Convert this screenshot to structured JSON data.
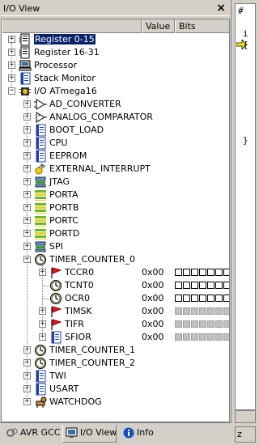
{
  "panel": {
    "title": "I/O View",
    "close_label": "×"
  },
  "columns": {
    "name": "",
    "value": "Value",
    "bits": "Bits"
  },
  "rows": [
    {
      "label": "Register 0-15",
      "icon": "register-file-icon",
      "level": 0,
      "expander": "+",
      "selected": true
    },
    {
      "label": "Register 16-31",
      "icon": "register-file-icon",
      "level": 0,
      "expander": "+"
    },
    {
      "label": "Processor",
      "icon": "processor-computer-icon",
      "level": 0,
      "expander": "+"
    },
    {
      "label": "Stack Monitor",
      "icon": "document-blue-icon",
      "level": 0,
      "expander": "+"
    },
    {
      "label": "I/O ATmega16",
      "icon": "chip-icon",
      "level": 0,
      "expander": "−"
    },
    {
      "label": "AD_CONVERTER",
      "icon": "analog-converter-icon",
      "level": 1,
      "expander": "+"
    },
    {
      "label": "ANALOG_COMPARATOR",
      "icon": "analog-comparator-icon",
      "level": 1,
      "expander": "+"
    },
    {
      "label": "BOOT_LOAD",
      "icon": "document-blue-icon",
      "level": 1,
      "expander": "+"
    },
    {
      "label": "CPU",
      "icon": "document-blue-icon",
      "level": 1,
      "expander": "+"
    },
    {
      "label": "EEPROM",
      "icon": "document-blue-icon",
      "level": 1,
      "expander": "+"
    },
    {
      "label": "EXTERNAL_INTERRUPT",
      "icon": "interrupt-icon",
      "level": 1,
      "expander": "+"
    },
    {
      "label": "JTAG",
      "icon": "jtag-icon",
      "level": 1,
      "expander": "+"
    },
    {
      "label": "PORTA",
      "icon": "port-icon",
      "level": 1,
      "expander": "+"
    },
    {
      "label": "PORTB",
      "icon": "port-icon",
      "level": 1,
      "expander": "+"
    },
    {
      "label": "PORTC",
      "icon": "port-icon",
      "level": 1,
      "expander": "+"
    },
    {
      "label": "PORTD",
      "icon": "port-icon",
      "level": 1,
      "expander": "+"
    },
    {
      "label": "SPI",
      "icon": "spi-icon",
      "level": 1,
      "expander": "+"
    },
    {
      "label": "TIMER_COUNTER_0",
      "icon": "timer-clock-icon",
      "level": 1,
      "expander": "−"
    },
    {
      "label": "TCCR0",
      "icon": "flag-icon",
      "level": 2,
      "expander": "+",
      "value": "0x00",
      "bits": "open"
    },
    {
      "label": "TCNT0",
      "icon": "timer-clock-icon",
      "level": 2,
      "value": "0x00",
      "bits": "open"
    },
    {
      "label": "OCR0",
      "icon": "timer-clock-icon",
      "level": 2,
      "value": "0x00",
      "bits": "open"
    },
    {
      "label": "TIMSK",
      "icon": "flag-icon",
      "level": 2,
      "expander": "+",
      "value": "0x00",
      "bits": "na"
    },
    {
      "label": "TIFR",
      "icon": "flag-icon",
      "level": 2,
      "expander": "+",
      "value": "0x00",
      "bits": "na"
    },
    {
      "label": "SFIOR",
      "icon": "document-blue-icon",
      "level": 2,
      "expander": "+",
      "value": "0x00",
      "bits": "na"
    },
    {
      "label": "TIMER_COUNTER_1",
      "icon": "timer-clock-icon",
      "level": 1,
      "expander": "+"
    },
    {
      "label": "TIMER_COUNTER_2",
      "icon": "timer-clock-icon",
      "level": 1,
      "expander": "+"
    },
    {
      "label": "TWI",
      "icon": "document-blue-icon",
      "level": 1,
      "expander": "+"
    },
    {
      "label": "USART",
      "icon": "document-blue-icon",
      "level": 1,
      "expander": "+"
    },
    {
      "label": "WATCHDOG",
      "icon": "watchdog-icon",
      "level": 1,
      "expander": "+"
    }
  ],
  "tabs": [
    {
      "label": "AVR GCC",
      "icon": "avr-gcc-icon",
      "active": false
    },
    {
      "label": "I/O View",
      "icon": "io-view-icon",
      "active": true
    },
    {
      "label": "Info",
      "icon": "info-icon",
      "active": false
    }
  ],
  "editor": {
    "line1": "#",
    "line2": "i",
    "line3": "{",
    "line4": "}",
    "tab_label": "z"
  },
  "colors": {
    "selection": "#0a246a",
    "window": "#d4d0c8"
  }
}
